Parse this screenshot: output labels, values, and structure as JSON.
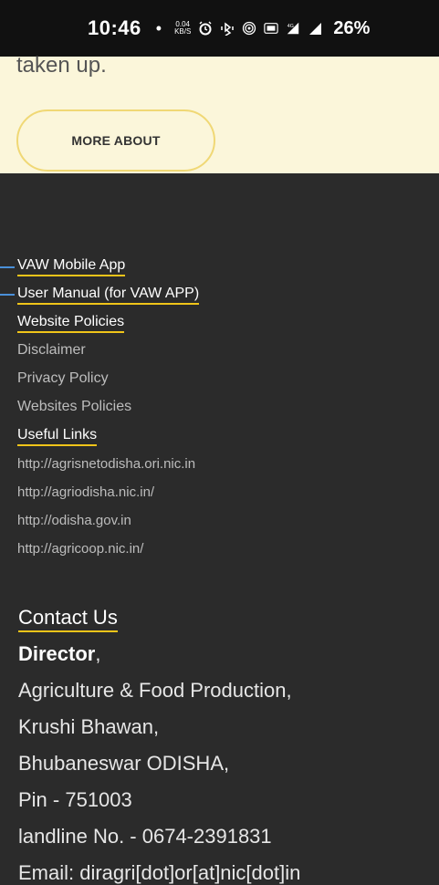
{
  "status_bar": {
    "time": "10:46",
    "dot": "•",
    "speed_value": "0.04",
    "speed_unit": "KB/S",
    "battery": "26%",
    "icons": [
      "alarm-icon",
      "vibrate-bluetooth-icon",
      "hotspot-icon",
      "volte-icon",
      "4g-signal-icon",
      "signal-icon"
    ]
  },
  "hero": {
    "text": "taken up.",
    "button_label": "MORE ABOUT"
  },
  "footer": {
    "headings": {
      "vaw_app": "VAW Mobile App",
      "user_manual": "User Manual (for VAW APP)",
      "website_policies": "Website Policies",
      "useful_links": "Useful Links"
    },
    "policies": [
      "Disclaimer",
      "Privacy Policy",
      "Websites Policies"
    ],
    "useful_links": [
      "http://agrisnetodisha.ori.nic.in",
      "http://agriodisha.nic.in/",
      "http://odisha.gov.in",
      "http://agricoop.nic.in/"
    ]
  },
  "contact": {
    "title": "Contact Us",
    "director": "Director",
    "director_suffix": ",",
    "lines": [
      "Agriculture & Food Production,",
      "Krushi Bhawan,",
      "Bhubaneswar ODISHA,",
      "Pin - 751003",
      "landline No. - 0674-2391831",
      "Email: diragri[dot]or[at]nic[dot]in"
    ]
  },
  "colors": {
    "cream": "#fbf6da",
    "dark": "#2b2b2b",
    "accent": "#f0c419",
    "arrow": "#4a90d9"
  }
}
